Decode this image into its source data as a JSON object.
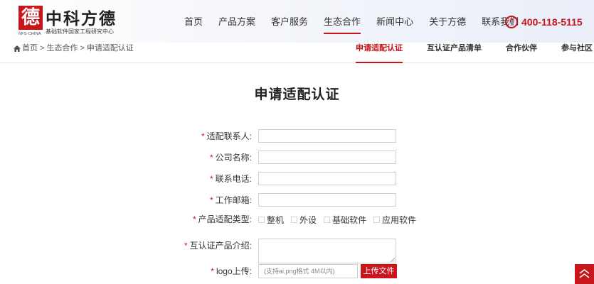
{
  "header": {
    "logo_mark": "德",
    "logo_name": "中科方德",
    "logo_en": "NFS·CHINA",
    "logo_sub": "基础软件国家工程研究中心",
    "nav": [
      {
        "label": "首页",
        "active": false
      },
      {
        "label": "产品方案",
        "active": false
      },
      {
        "label": "客户服务",
        "active": false
      },
      {
        "label": "生态合作",
        "active": true
      },
      {
        "label": "新闻中心",
        "active": false
      },
      {
        "label": "关于方德",
        "active": false
      },
      {
        "label": "联系我们",
        "active": false
      }
    ],
    "hotline": "400-118-5115"
  },
  "breadcrumb": {
    "items": [
      "首页",
      ">",
      "生态合作",
      ">",
      "申请适配认证"
    ]
  },
  "subnav": [
    {
      "label": "申请适配认证",
      "active": true
    },
    {
      "label": "互认证产品清单",
      "active": false
    },
    {
      "label": "合作伙伴",
      "active": false
    },
    {
      "label": "参与社区",
      "active": false
    }
  ],
  "page_title": "申请适配认证",
  "form": {
    "required_mark": "*",
    "contact_label": "适配联系人:",
    "contact_value": "",
    "company_label": "公司名称:",
    "company_value": "",
    "phone_label": "联系电话:",
    "phone_value": "",
    "email_label": "工作邮箱:",
    "email_value": "",
    "type_label": "产品适配类型:",
    "type_options": [
      "整机",
      "外设",
      "基础软件",
      "应用软件"
    ],
    "intro_label": "互认证产品介绍:",
    "intro_value": "",
    "logo_label": "logo上传:",
    "logo_placeholder": "(支持ai,png格式 4M以内)",
    "upload_label": "上传文件"
  },
  "colors": {
    "accent": "#c8161d",
    "text": "#333333",
    "border": "#cfcfcf"
  }
}
